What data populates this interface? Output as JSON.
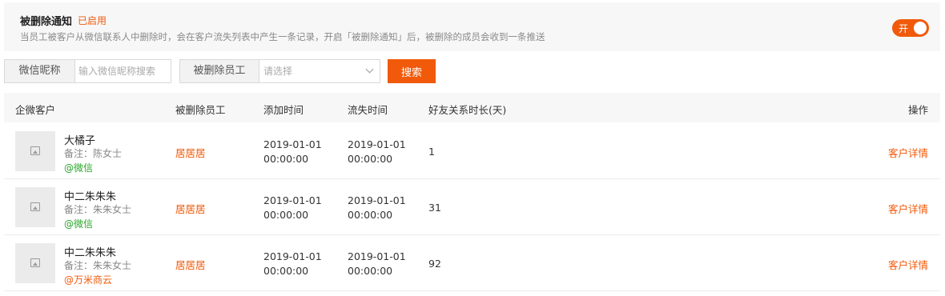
{
  "notice": {
    "title": "被删除通知",
    "status": "已启用",
    "description": "当员工被客户从微信联系人中删除时，会在客户流失列表中产生一条记录，开启「被删除通知」后，被删除的成员会收到一条推送",
    "toggle_label": "开",
    "toggle_on": true
  },
  "filters": {
    "nickname_label": "微信昵称",
    "nickname_placeholder": "输入微信昵称搜索",
    "employee_label": "被删除员工",
    "employee_placeholder": "请选择",
    "search_label": "搜索"
  },
  "table": {
    "headers": [
      "企微客户",
      "被删除员工",
      "添加时间",
      "流失时间",
      "好友关系时长(天)",
      "操作"
    ],
    "rows": [
      {
        "name": "大橘子",
        "remark": "备注：陈女士",
        "source": "@微信",
        "source_color": "#2aa52a",
        "employee": "居居居",
        "added_date": "2019-01-01",
        "added_time": "00:00:00",
        "lost_date": "2019-01-01",
        "lost_time": "00:00:00",
        "days": "1",
        "action": "客户详情"
      },
      {
        "name": "中二朱朱朱",
        "remark": "备注：朱朱女士",
        "source": "@微信",
        "source_color": "#2aa52a",
        "employee": "居居居",
        "added_date": "2019-01-01",
        "added_time": "00:00:00",
        "lost_date": "2019-01-01",
        "lost_time": "00:00:00",
        "days": "31",
        "action": "客户详情"
      },
      {
        "name": "中二朱朱朱",
        "remark": "备注：朱朱女士",
        "source": "@万米商云",
        "source_color": "#f05a0a",
        "employee": "居居居",
        "added_date": "2019-01-01",
        "added_time": "00:00:00",
        "lost_date": "2019-01-01",
        "lost_time": "00:00:00",
        "days": "92",
        "action": "客户详情"
      }
    ]
  },
  "colors": {
    "accent": "#f05a0a",
    "wechat_green": "#2aa52a"
  }
}
